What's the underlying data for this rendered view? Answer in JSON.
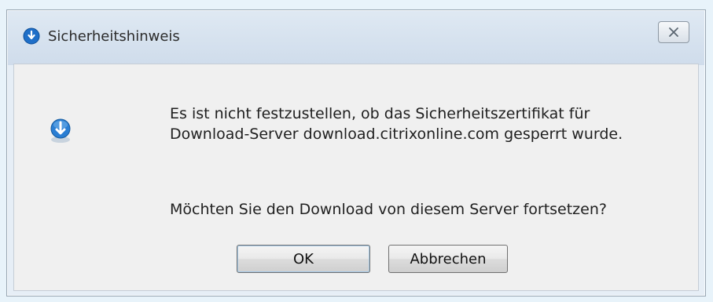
{
  "dialog": {
    "title": "Sicherheitshinweis",
    "icons": {
      "title": "globe-download-icon",
      "close": "close-icon",
      "content": "globe-download-icon"
    },
    "message_line1": "Es ist nicht festzustellen, ob das Sicherheitszertifikat für",
    "message_line2": "Download-Server download.citrixonline.com gesperrt wurde.",
    "question": "Möchten Sie den Download von diesem Server fortsetzen?",
    "ok_label": "OK",
    "cancel_label": "Abbrechen"
  },
  "colors": {
    "accent": "#1f6fc8",
    "background": "#e8f3fa",
    "content_bg": "#f0f0f0"
  }
}
